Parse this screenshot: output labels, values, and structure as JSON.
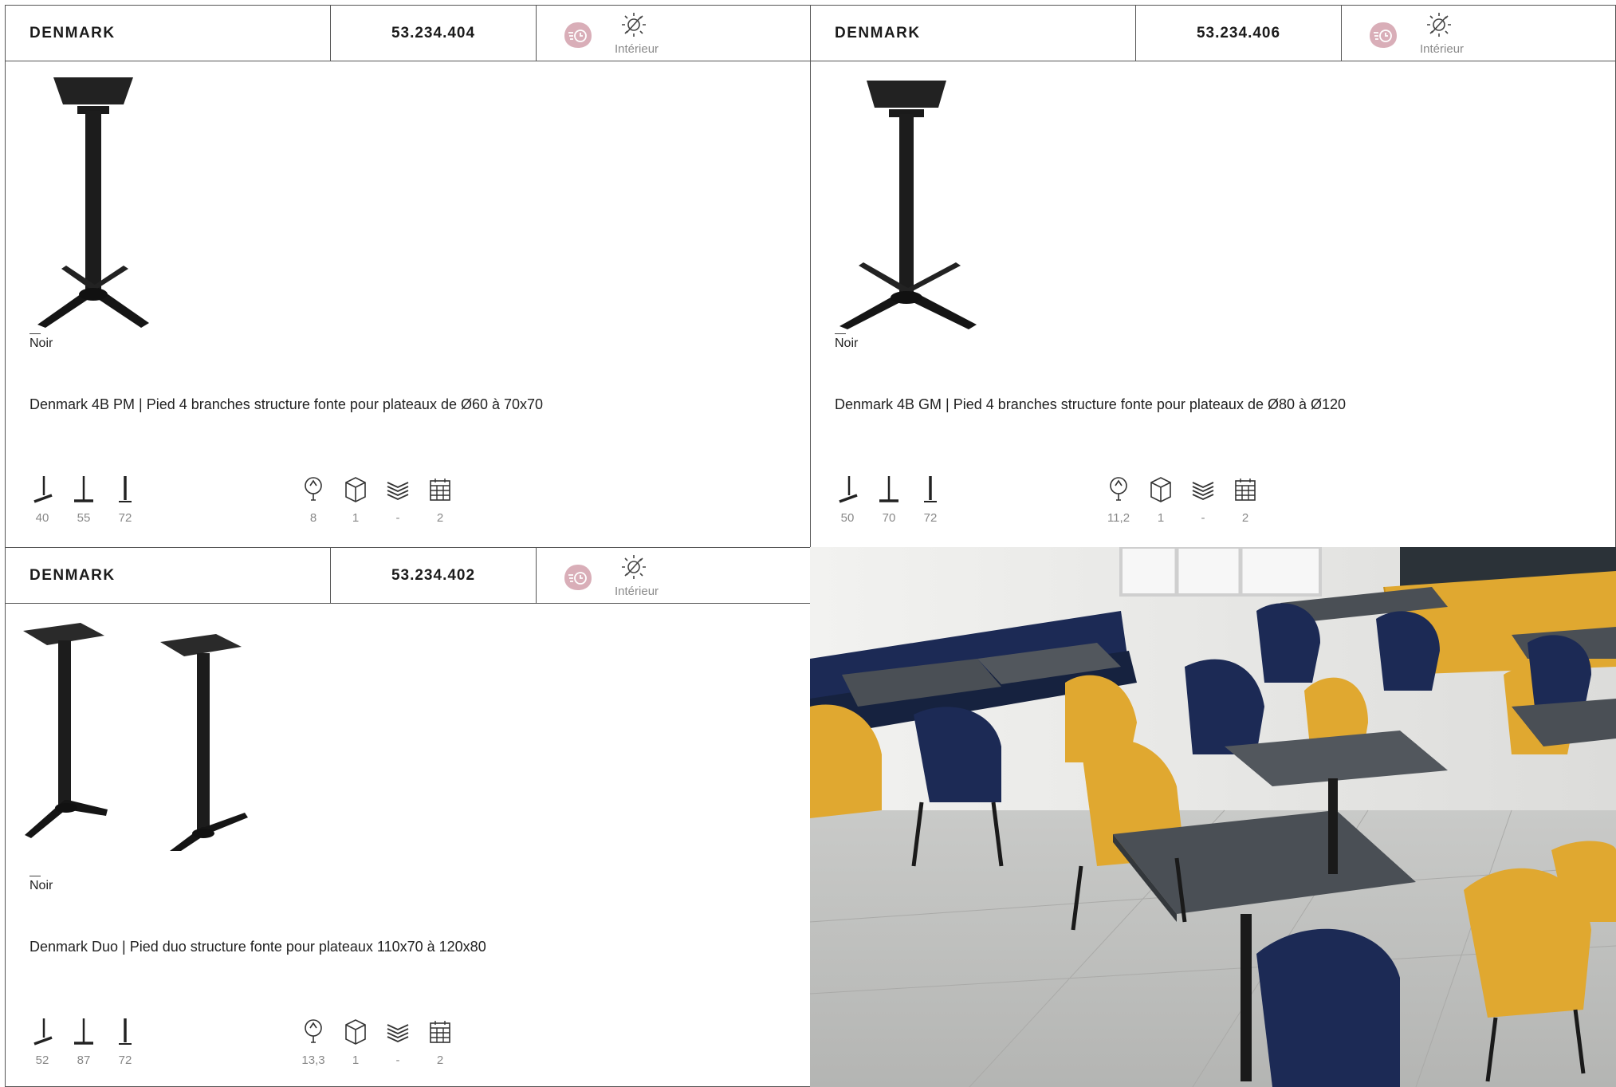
{
  "cards": [
    {
      "name": "DENMARK",
      "code": "53.234.404",
      "env_label": "Intérieur",
      "dash": "—",
      "color": "Noir",
      "description": "Denmark 4B PM | Pied 4 branches structure fonte pour plateaux de Ø60 à 70x70",
      "dims": [
        "40",
        "55",
        "72"
      ],
      "specs": [
        "8",
        "1",
        "-",
        "2"
      ]
    },
    {
      "name": "DENMARK",
      "code": "53.234.406",
      "env_label": "Intérieur",
      "dash": "—",
      "color": "Noir",
      "description": "Denmark 4B GM | Pied 4 branches structure fonte pour plateaux de Ø80 à Ø120",
      "dims": [
        "50",
        "70",
        "72"
      ],
      "specs": [
        "11,2",
        "1",
        "-",
        "2"
      ]
    },
    {
      "name": "DENMARK",
      "code": "53.234.402",
      "env_label": "Intérieur",
      "dash": "—",
      "color": "Noir",
      "description": "Denmark Duo | Pied duo structure fonte pour plateaux 110x70 à 120x80",
      "dims": [
        "52",
        "87",
        "72"
      ],
      "specs": [
        "13,3",
        "1",
        "-",
        "2"
      ]
    }
  ],
  "icons": {
    "badge": "fast-delivery-icon",
    "environment": "sun-icon",
    "dims": [
      "leg-width-icon",
      "leg-depth-icon",
      "leg-height-icon"
    ],
    "specs": [
      "weight-icon",
      "box-icon",
      "stack-icon",
      "calendar-icon"
    ]
  },
  "colors": {
    "border": "#555555",
    "badge": "#d9aeb8",
    "muted_text": "#888888",
    "chair_yellow": "#e0a830",
    "chair_navy": "#1c2a55",
    "table_top": "#4a4f55"
  }
}
